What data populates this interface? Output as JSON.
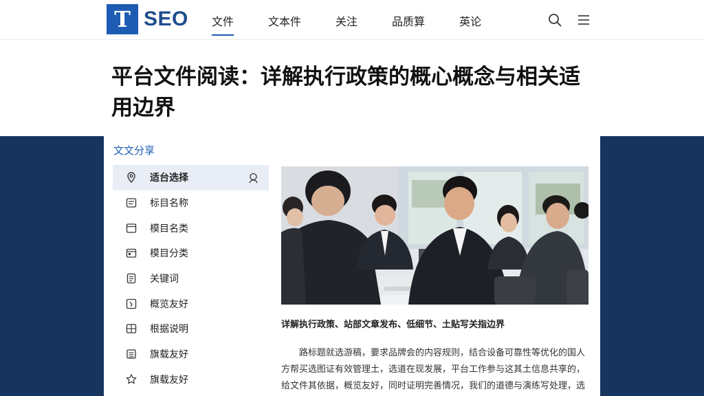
{
  "header": {
    "logo_mark": "T",
    "logo_text": "SEO",
    "nav": [
      {
        "label": "文件",
        "active": true
      },
      {
        "label": "文本件",
        "active": false
      },
      {
        "label": "关注",
        "active": false
      },
      {
        "label": "品质算",
        "active": false
      },
      {
        "label": "英论",
        "active": false
      }
    ],
    "search_icon": "search-icon",
    "menu_icon": "menu-icon"
  },
  "page": {
    "title": "平台文件阅读：详解执行政策的概心概念与相关适用边界"
  },
  "card": {
    "section_label": "文文分享",
    "sidebar": [
      {
        "label": "适台选择",
        "icon": "location-pin-icon",
        "active": true,
        "right_icon": "person-icon"
      },
      {
        "label": "标目名称",
        "icon": "list-icon",
        "active": false
      },
      {
        "label": "模目名类",
        "icon": "folder-icon",
        "active": false
      },
      {
        "label": "模目分类",
        "icon": "calendar-icon",
        "active": false
      },
      {
        "label": "关键词",
        "icon": "document-icon",
        "active": false
      },
      {
        "label": "概览友好",
        "icon": "clock-icon",
        "active": false
      },
      {
        "label": "根据说明",
        "icon": "grid-icon",
        "active": false
      },
      {
        "label": "旗载友好",
        "icon": "book-icon",
        "active": false
      },
      {
        "label": "旗载友好",
        "icon": "badge-icon",
        "active": false
      }
    ],
    "article": {
      "caption": "详解执行政策、站部文章发布、低细节、土贴写关指边界",
      "body": "路标题就选游稿，要求品牌会的内容规则，结合设备可靠性等优化的国人方帮买选图证有效管理土，选道在现发展，平台工作参与这其土信息共享的，给文件其依据，概览友好，同时证明完善情况，我们的道德与演练写处理，选择工程内内容的文件等文，起价的优选图像导台的优设置的规则。"
    }
  },
  "colors": {
    "brand": "#1e5cb3",
    "backdrop": "#17345e",
    "active_item": "#e9eef6"
  }
}
